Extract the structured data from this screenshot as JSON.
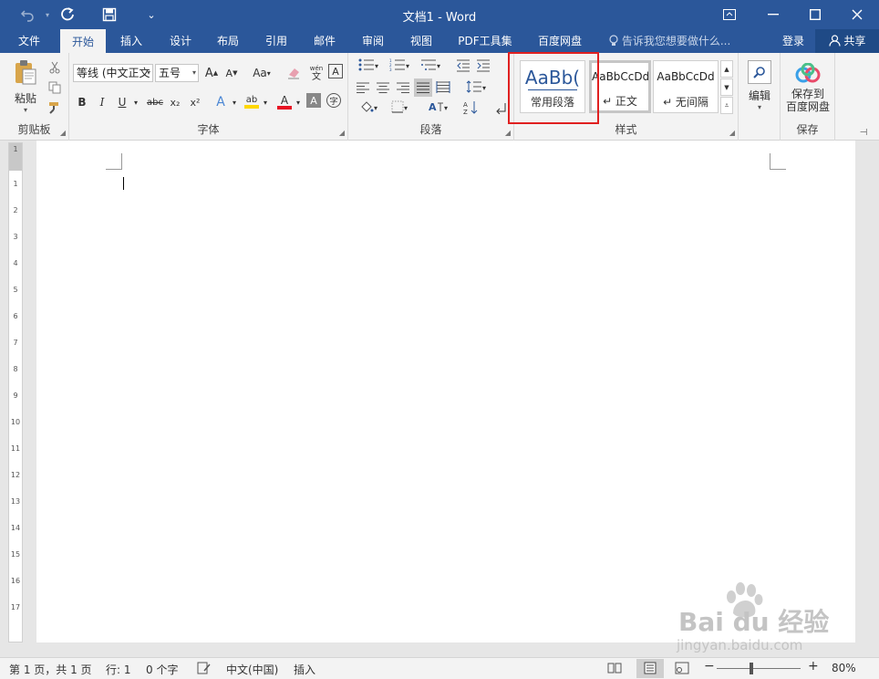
{
  "titlebar": {
    "title": "文档1 - Word",
    "undo_icon": "undo-icon",
    "redo_icon": "redo-icon",
    "save_icon": "save-icon",
    "customize_icon": "customize-quick-access-icon"
  },
  "tabs": [
    "文件",
    "开始",
    "插入",
    "设计",
    "布局",
    "引用",
    "邮件",
    "审阅",
    "视图",
    "PDF工具集",
    "百度网盘"
  ],
  "active_tab": "开始",
  "tell_me": "告诉我您想要做什么...",
  "login": "登录",
  "share": "共享",
  "clipboard": {
    "paste": "粘贴",
    "label": "剪贴板"
  },
  "font": {
    "font_name": "等线 (中文正文",
    "font_size": "五号",
    "label": "字体",
    "grow": "A",
    "shrink": "A",
    "case": "Aa",
    "phonetic_top": "wén",
    "phonetic_bottom": "文",
    "border_char": "A",
    "bold": "B",
    "italic": "I",
    "underline": "U",
    "strike": "abc",
    "subscript": "x₂",
    "superscript": "x²",
    "effects": "A",
    "highlight": "ab",
    "font_color": "A",
    "shading": "A",
    "enclose": "字"
  },
  "paragraph": {
    "label": "段落"
  },
  "styles": {
    "label": "样式",
    "items": [
      {
        "preview": "AaBb(",
        "name": "常用段落"
      },
      {
        "preview": "AaBbCcDd",
        "name": "↵ 正文"
      },
      {
        "preview": "AaBbCcDd",
        "name": "↵ 无间隔"
      }
    ]
  },
  "editing": {
    "label": "编辑"
  },
  "save_group": {
    "button_line1": "保存到",
    "button_line2": "百度网盘",
    "label": "保存"
  },
  "ruler": [
    "1",
    "1",
    "2",
    "3",
    "4",
    "5",
    "6",
    "7",
    "8",
    "9",
    "10",
    "11",
    "12",
    "13",
    "14",
    "15",
    "16",
    "17"
  ],
  "status": {
    "page": "第 1 页，共 1 页",
    "line": "行: 1",
    "words": "0 个字",
    "language": "中文(中国)",
    "mode": "插入",
    "zoom": "80%"
  },
  "watermark": {
    "brand": "Bai  du 经验",
    "url": "jingyan.baidu.com"
  },
  "colors": {
    "title_blue": "#2b579a",
    "highlight_red": "#e02020",
    "font_color_red": "#e81123",
    "highlight_yellow": "#ffd700"
  }
}
